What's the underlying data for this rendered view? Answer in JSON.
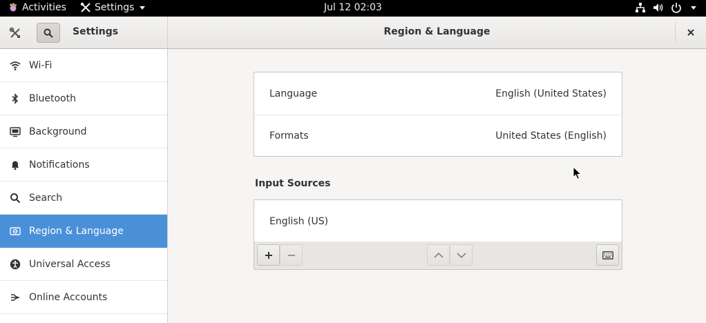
{
  "topbar": {
    "activities": "Activities",
    "app_menu": "Settings",
    "clock": "Jul 12  02:03"
  },
  "header": {
    "sidebar_title": "Settings",
    "page_title": "Region & Language"
  },
  "sidebar": {
    "items": [
      {
        "label": "Wi-Fi",
        "icon": "wifi-icon"
      },
      {
        "label": "Bluetooth",
        "icon": "bluetooth-icon"
      },
      {
        "label": "Background",
        "icon": "background-icon"
      },
      {
        "label": "Notifications",
        "icon": "bell-icon"
      },
      {
        "label": "Search",
        "icon": "search-icon"
      },
      {
        "label": "Region & Language",
        "icon": "region-icon",
        "selected": true
      },
      {
        "label": "Universal Access",
        "icon": "accessibility-icon"
      },
      {
        "label": "Online Accounts",
        "icon": "online-accounts-icon"
      }
    ]
  },
  "main": {
    "language_label": "Language",
    "language_value": "English (United States)",
    "formats_label": "Formats",
    "formats_value": "United States (English)",
    "input_sources_title": "Input Sources",
    "input_sources": [
      "English (US)"
    ]
  },
  "colors": {
    "accent": "#4a90d9",
    "topbar": "#000000",
    "background": "#f6f5f4"
  }
}
